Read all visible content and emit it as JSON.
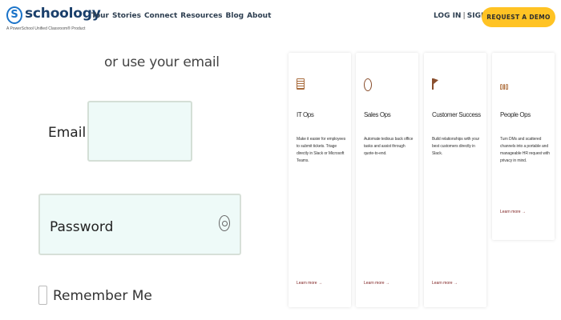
{
  "header": {
    "logo_mark": "S",
    "logo_text": "schoology",
    "logo_tagline": "A PowerSchool Unified Classroom® Product",
    "nav": [
      "Tour",
      "Stories",
      "Connect",
      "Resources",
      "Blog",
      "About"
    ],
    "login": "LOG IN",
    "separator": "|",
    "signup": "SIGN UP",
    "demo_button": "REQUEST A DEMO",
    "accent_color": "#ffc324"
  },
  "login_form": {
    "heading": "or use your email",
    "email_label": "Email",
    "email_value": "",
    "password_label": "Password",
    "password_value": "",
    "password_icon": "eye-icon",
    "remember_label": "Remember Me"
  },
  "cards": [
    {
      "icon": "document-icon",
      "title": "IT Ops",
      "desc": "Make it easier for employees to submit tickets. Triage directly in Slack or Microsoft Teams.",
      "link": "Learn more →"
    },
    {
      "icon": "lightbulb-icon",
      "title": "Sales Ops",
      "desc": "Automate tedious back office tasks and assist through quote-to-end.",
      "link": "Learn more →"
    },
    {
      "icon": "flag-icon",
      "title": "Customer Success",
      "desc": "Build relationships with your best customers directly in Slack.",
      "link": "Learn more →"
    },
    {
      "icon": "people-icon",
      "title": "People Ops",
      "desc": "Turn DMs and scattered channels into a portable and manageable HR request with privacy in mind.",
      "link": "Learn more →"
    }
  ]
}
